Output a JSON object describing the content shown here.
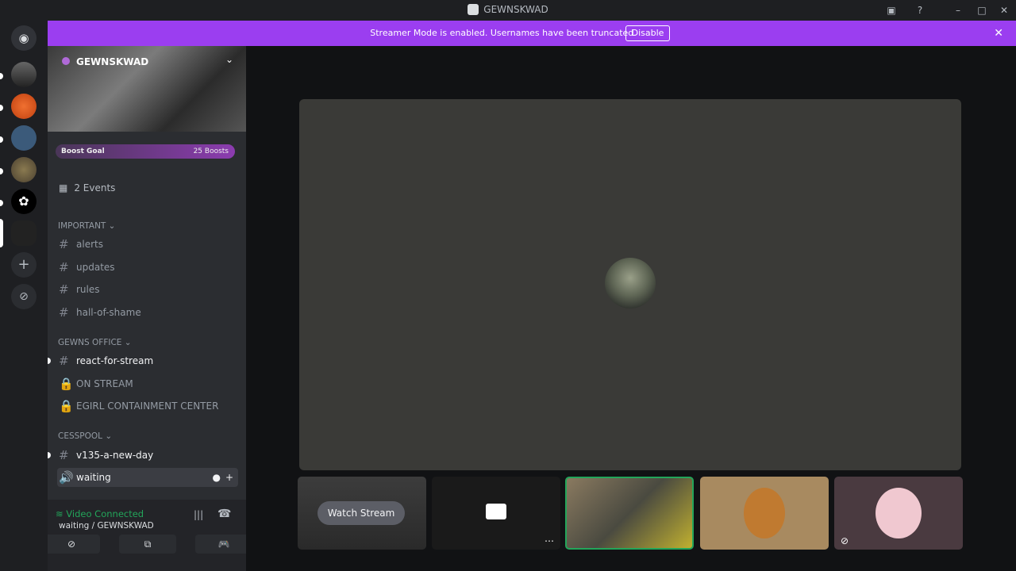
{
  "window": {
    "title": "GEWNSKWAD"
  },
  "banner": {
    "message": "Streamer Mode is enabled. Usernames have been truncated.",
    "disable_label": "Disable"
  },
  "server": {
    "name": "GEWNSKWAD",
    "boost_goal": "Boost Goal",
    "boost_count": "25 Boosts"
  },
  "events": {
    "label": "2 Events"
  },
  "categories": {
    "important": "IMPORTANT",
    "gewns_office": "GEWNS OFFICE",
    "cesspool": "CESSPOOL"
  },
  "channels": {
    "alerts": "alerts",
    "updates": "updates",
    "rules": "rules",
    "hall_of_shame": "hall-of-shame",
    "react_for_stream": "react-for-stream",
    "on_stream": "ON STREAM",
    "egirl": "EGIRL CONTAINMENT CENTER",
    "v135": "v135-a-new-day",
    "waiting": "waiting"
  },
  "voice": {
    "status": "Video Connected",
    "location": "waiting / GEWNSKWAD"
  },
  "stream": {
    "watch_label": "Watch Stream"
  },
  "colors": {
    "accent": "#9b3ef0",
    "connected": "#23a55a",
    "speaking_border": "#23a55a"
  },
  "icons": {
    "hash": "hash-icon",
    "lock": "lock-icon",
    "speaker": "speaker-icon",
    "calendar": "calendar-icon",
    "camera": "camera-icon",
    "screen_share": "screen-share-icon",
    "activity": "activity-icon",
    "disconnect": "disconnect-icon",
    "noise": "noise-suppression-icon",
    "more": "more-icon",
    "muted": "muted-icon",
    "help": "help-icon",
    "inbox": "inbox-icon",
    "close": "close-icon",
    "add_server": "add-server-icon",
    "discover": "discover-icon"
  }
}
